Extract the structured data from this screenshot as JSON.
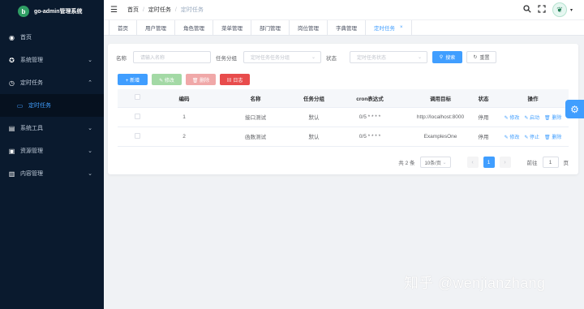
{
  "app": {
    "title": "go-admin管理系统",
    "logo_letter": "b"
  },
  "sidebar": {
    "items": [
      {
        "label": "首页",
        "icon": "dashboard-icon",
        "glyph": "◉"
      },
      {
        "label": "系统管理",
        "icon": "system-icon",
        "glyph": "✪",
        "arrow": "⌄"
      },
      {
        "label": "定时任务",
        "icon": "clock-icon",
        "glyph": "◷",
        "arrow": "⌃"
      },
      {
        "label": "定时任务",
        "icon": "job-icon",
        "glyph": "▭",
        "sub": true
      },
      {
        "label": "系统工具",
        "icon": "tools-icon",
        "glyph": "▤",
        "arrow": "⌄"
      },
      {
        "label": "资源管理",
        "icon": "resource-icon",
        "glyph": "▣",
        "arrow": "⌄"
      },
      {
        "label": "内容管理",
        "icon": "content-icon",
        "glyph": "▥",
        "arrow": "⌄"
      }
    ]
  },
  "breadcrumb": {
    "home": "首页",
    "sep": "/",
    "parent": "定时任务",
    "current": "定时任务"
  },
  "tags": [
    {
      "label": "首页"
    },
    {
      "label": "用户管理"
    },
    {
      "label": "角色管理"
    },
    {
      "label": "菜单管理"
    },
    {
      "label": "部门管理"
    },
    {
      "label": "岗位管理"
    },
    {
      "label": "字典管理"
    },
    {
      "label": "定时任务",
      "active": true,
      "close": "×"
    }
  ],
  "filter": {
    "name_label": "名称",
    "name_placeholder": "请输入名称",
    "group_label": "任务分组",
    "group_placeholder": "定时任务任务分组",
    "status_label": "状态",
    "status_placeholder": "定时任务状态",
    "search": "搜索",
    "reset": "重置"
  },
  "actions": {
    "add": "+ 新增",
    "edit": "✎ 修改",
    "delete": "🗑 删除",
    "log": "▤ 日志"
  },
  "table": {
    "headers": [
      "编码",
      "名称",
      "任务分组",
      "cron表达式",
      "调用目标",
      "状态",
      "操作"
    ],
    "rows": [
      {
        "id": "1",
        "name": "接口测试",
        "group": "默认",
        "cron": "0/5 * * * *",
        "target": "http://localhost:8000",
        "status": "停用",
        "ops": [
          "✎ 修改",
          "✎ 启动",
          "🗑 删除"
        ]
      },
      {
        "id": "2",
        "name": "函数测试",
        "group": "默认",
        "cron": "0/5 * * * *",
        "target": "ExamplesOne",
        "status": "停用",
        "ops": [
          "✎ 修改",
          "✎ 停止",
          "🗑 删除"
        ]
      }
    ]
  },
  "pagination": {
    "total": "共 2 条",
    "page_size": "10条/页",
    "current": "1",
    "goto": "前往",
    "goto_value": "1",
    "page_suffix": "页",
    "prev": "‹",
    "next": "›"
  },
  "watermark": "知乎 @wenjianzhang"
}
